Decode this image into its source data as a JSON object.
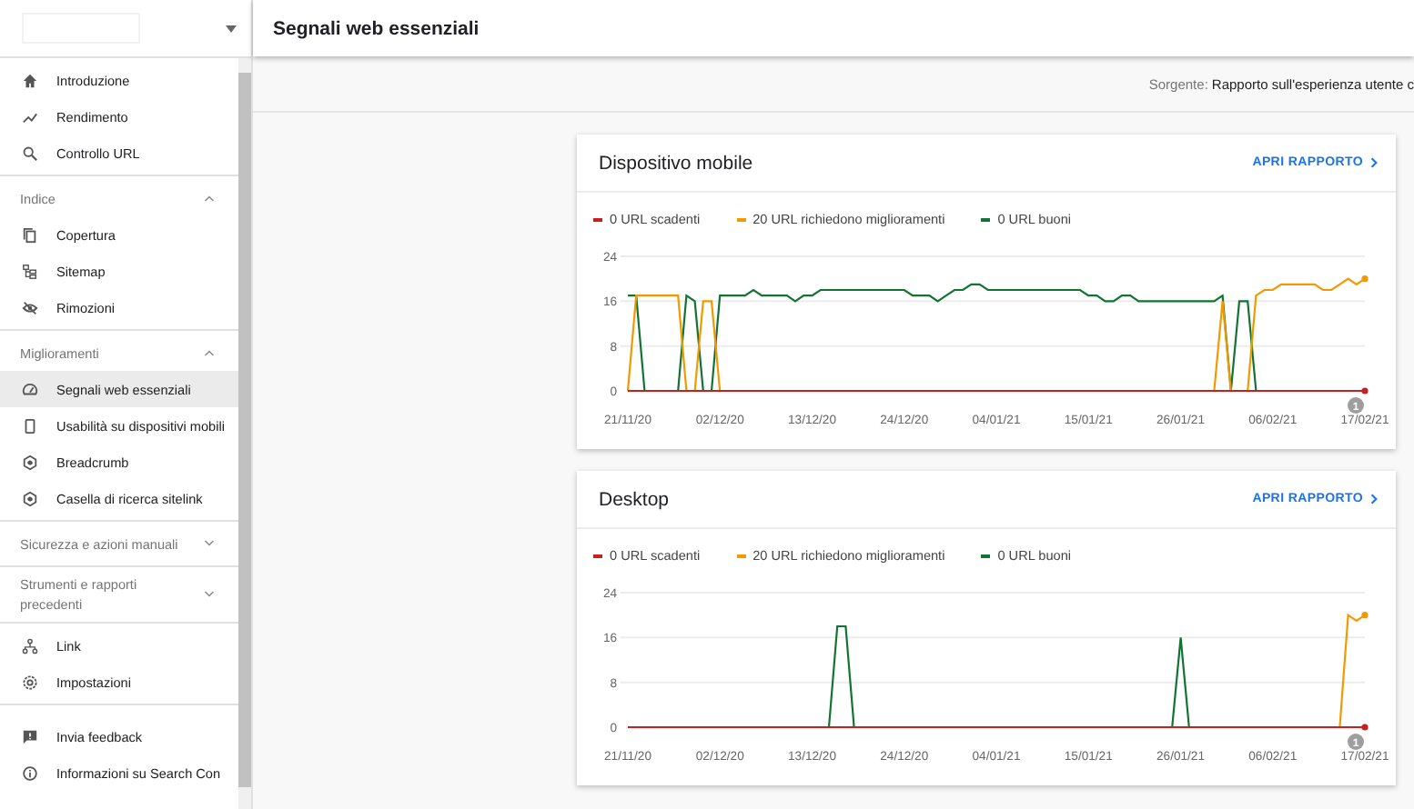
{
  "sidebar": {
    "groups": [
      {
        "kind": "links",
        "items": [
          {
            "label": "Introduzione",
            "selected": false
          },
          {
            "label": "Rendimento",
            "selected": false
          },
          {
            "label": "Controllo URL",
            "selected": false
          }
        ]
      },
      {
        "kind": "section",
        "title": "Indice",
        "expanded": true,
        "items": [
          {
            "label": "Copertura",
            "selected": false
          },
          {
            "label": "Sitemap",
            "selected": false
          },
          {
            "label": "Rimozioni",
            "selected": false
          }
        ]
      },
      {
        "kind": "section",
        "title": "Miglioramenti",
        "expanded": true,
        "items": [
          {
            "label": "Segnali web essenziali",
            "selected": true
          },
          {
            "label": "Usabilità su dispositivi mobili",
            "selected": false
          },
          {
            "label": "Breadcrumb",
            "selected": false
          },
          {
            "label": "Casella di ricerca sitelink",
            "selected": false
          }
        ]
      },
      {
        "kind": "section",
        "title": "Sicurezza e azioni manuali",
        "expanded": false
      },
      {
        "kind": "section",
        "title": "Strumenti e rapporti precedenti",
        "expanded": false
      },
      {
        "kind": "links",
        "items": [
          {
            "label": "Link",
            "selected": false
          },
          {
            "label": "Impostazioni",
            "selected": false
          }
        ]
      },
      {
        "kind": "footer",
        "items": [
          {
            "label": "Invia feedback",
            "selected": false
          },
          {
            "label": "Informazioni su Search Con",
            "selected": false
          }
        ]
      }
    ]
  },
  "header": {
    "title": "Segnali web essenziali"
  },
  "source": {
    "label": "Sorgente:",
    "value": "Rapporto sull'esperienza utente c"
  },
  "cards": [
    {
      "title": "Dispositivo mobile",
      "link": "APRI RAPPORTO",
      "chart_data": {
        "type": "line",
        "categories": [
          "21/11/20",
          null,
          null,
          null,
          null,
          null,
          null,
          null,
          null,
          null,
          null,
          "02/12/20",
          null,
          null,
          null,
          null,
          null,
          null,
          null,
          null,
          null,
          null,
          "13/12/20",
          null,
          null,
          null,
          null,
          null,
          null,
          null,
          null,
          null,
          null,
          "24/12/20",
          null,
          null,
          null,
          null,
          null,
          null,
          null,
          null,
          null,
          null,
          "04/01/21",
          null,
          null,
          null,
          null,
          null,
          null,
          null,
          null,
          null,
          null,
          "15/01/21",
          null,
          null,
          null,
          null,
          null,
          null,
          null,
          null,
          null,
          null,
          "26/01/21",
          null,
          null,
          null,
          null,
          null,
          null,
          null,
          null,
          null,
          null,
          "06/02/21",
          null,
          null,
          null,
          null,
          null,
          null,
          null,
          null,
          null,
          null,
          "17/02/21"
        ],
        "series": [
          {
            "name": "0 URL scadenti",
            "color": "#c5221f",
            "values": [
              0,
              0,
              0,
              0,
              0,
              0,
              0,
              0,
              0,
              0,
              0,
              0,
              0,
              0,
              0,
              0,
              0,
              0,
              0,
              0,
              0,
              0,
              0,
              0,
              0,
              0,
              0,
              0,
              0,
              0,
              0,
              0,
              0,
              0,
              0,
              0,
              0,
              0,
              0,
              0,
              0,
              0,
              0,
              0,
              0,
              0,
              0,
              0,
              0,
              0,
              0,
              0,
              0,
              0,
              0,
              0,
              0,
              0,
              0,
              0,
              0,
              0,
              0,
              0,
              0,
              0,
              0,
              0,
              0,
              0,
              0,
              0,
              0,
              0,
              0,
              0,
              0,
              0,
              0,
              0,
              0,
              0,
              0,
              0,
              0,
              0,
              0,
              0,
              0
            ]
          },
          {
            "name": "20 URL richiedono miglioramenti",
            "color": "#f29900",
            "values": [
              0,
              17,
              17,
              17,
              17,
              17,
              17,
              0,
              0,
              16,
              16,
              0,
              null,
              null,
              null,
              null,
              null,
              null,
              null,
              null,
              null,
              null,
              null,
              null,
              null,
              null,
              null,
              null,
              null,
              null,
              null,
              null,
              null,
              null,
              null,
              null,
              null,
              null,
              null,
              null,
              null,
              null,
              null,
              null,
              null,
              null,
              null,
              null,
              null,
              null,
              null,
              null,
              null,
              null,
              null,
              null,
              null,
              null,
              null,
              null,
              null,
              null,
              null,
              null,
              null,
              null,
              null,
              null,
              null,
              null,
              0,
              16,
              0,
              null,
              0,
              17,
              18,
              18,
              19,
              19,
              19,
              19,
              19,
              18,
              18,
              19,
              20,
              19,
              20
            ]
          },
          {
            "name": "0 URL buoni",
            "color": "#137333",
            "values": [
              17,
              17,
              0,
              null,
              null,
              null,
              0,
              17,
              16,
              0,
              0,
              17,
              17,
              17,
              17,
              18,
              17,
              17,
              17,
              17,
              16,
              17,
              17,
              18,
              18,
              18,
              18,
              18,
              18,
              18,
              18,
              18,
              18,
              18,
              17,
              17,
              17,
              16,
              17,
              18,
              18,
              19,
              19,
              18,
              18,
              18,
              18,
              18,
              18,
              18,
              18,
              18,
              18,
              18,
              18,
              17,
              17,
              16,
              16,
              17,
              17,
              16,
              16,
              16,
              16,
              16,
              16,
              16,
              16,
              16,
              16,
              17,
              0,
              16,
              16,
              0,
              null,
              null,
              null,
              null,
              null,
              null,
              null,
              null,
              null,
              null,
              null,
              null,
              null
            ]
          }
        ],
        "ylim": [
          0,
          24
        ],
        "yticks": [
          0,
          8,
          16,
          24
        ],
        "annotations": [
          "1"
        ]
      }
    },
    {
      "title": "Desktop",
      "link": "APRI RAPPORTO",
      "chart_data": {
        "type": "line",
        "categories": [
          "21/11/20",
          null,
          null,
          null,
          null,
          null,
          null,
          null,
          null,
          null,
          null,
          "02/12/20",
          null,
          null,
          null,
          null,
          null,
          null,
          null,
          null,
          null,
          null,
          "13/12/20",
          null,
          null,
          null,
          null,
          null,
          null,
          null,
          null,
          null,
          null,
          "24/12/20",
          null,
          null,
          null,
          null,
          null,
          null,
          null,
          null,
          null,
          null,
          "04/01/21",
          null,
          null,
          null,
          null,
          null,
          null,
          null,
          null,
          null,
          null,
          "15/01/21",
          null,
          null,
          null,
          null,
          null,
          null,
          null,
          null,
          null,
          null,
          "26/01/21",
          null,
          null,
          null,
          null,
          null,
          null,
          null,
          null,
          null,
          null,
          "06/02/21",
          null,
          null,
          null,
          null,
          null,
          null,
          null,
          null,
          null,
          null,
          "17/02/21"
        ],
        "series": [
          {
            "name": "0 URL scadenti",
            "color": "#c5221f",
            "values": [
              0,
              0,
              0,
              0,
              0,
              0,
              0,
              0,
              0,
              0,
              0,
              0,
              0,
              0,
              0,
              0,
              0,
              0,
              0,
              0,
              0,
              0,
              0,
              0,
              0,
              0,
              0,
              0,
              0,
              0,
              0,
              0,
              0,
              0,
              0,
              0,
              0,
              0,
              0,
              0,
              0,
              0,
              0,
              0,
              0,
              0,
              0,
              0,
              0,
              0,
              0,
              0,
              0,
              0,
              0,
              0,
              0,
              0,
              0,
              0,
              0,
              0,
              0,
              0,
              0,
              0,
              0,
              0,
              0,
              0,
              0,
              0,
              0,
              0,
              0,
              0,
              0,
              0,
              0,
              0,
              0,
              0,
              0,
              0,
              0,
              0,
              0,
              0,
              0
            ]
          },
          {
            "name": "20 URL richiedono miglioramenti",
            "color": "#f29900",
            "values": [
              null,
              null,
              null,
              null,
              null,
              null,
              null,
              null,
              null,
              null,
              null,
              null,
              null,
              null,
              null,
              null,
              null,
              null,
              null,
              null,
              null,
              null,
              null,
              null,
              null,
              null,
              null,
              null,
              null,
              null,
              null,
              null,
              null,
              null,
              null,
              null,
              null,
              null,
              null,
              null,
              null,
              null,
              null,
              null,
              null,
              null,
              null,
              null,
              null,
              null,
              null,
              null,
              null,
              null,
              null,
              null,
              null,
              null,
              null,
              null,
              null,
              null,
              null,
              null,
              null,
              null,
              null,
              null,
              null,
              null,
              null,
              null,
              null,
              null,
              null,
              null,
              null,
              null,
              null,
              null,
              null,
              null,
              null,
              null,
              null,
              0,
              20,
              19,
              20
            ]
          },
          {
            "name": "0 URL buoni",
            "color": "#137333",
            "values": [
              null,
              null,
              null,
              null,
              null,
              null,
              null,
              null,
              null,
              null,
              null,
              null,
              null,
              null,
              null,
              null,
              null,
              null,
              null,
              null,
              null,
              null,
              null,
              null,
              0,
              18,
              18,
              0,
              null,
              null,
              null,
              null,
              null,
              null,
              null,
              null,
              null,
              null,
              null,
              null,
              null,
              null,
              null,
              null,
              null,
              null,
              null,
              null,
              null,
              null,
              null,
              null,
              null,
              null,
              null,
              null,
              null,
              null,
              null,
              null,
              null,
              null,
              null,
              null,
              null,
              0,
              16,
              0,
              null,
              null,
              null,
              null,
              null,
              null,
              null,
              null,
              null,
              null,
              null,
              null,
              null,
              null,
              null,
              null,
              null,
              null,
              null,
              null,
              null
            ]
          }
        ],
        "ylim": [
          0,
          24
        ],
        "yticks": [
          0,
          8,
          16,
          24
        ],
        "annotations": [
          "1"
        ]
      }
    }
  ]
}
